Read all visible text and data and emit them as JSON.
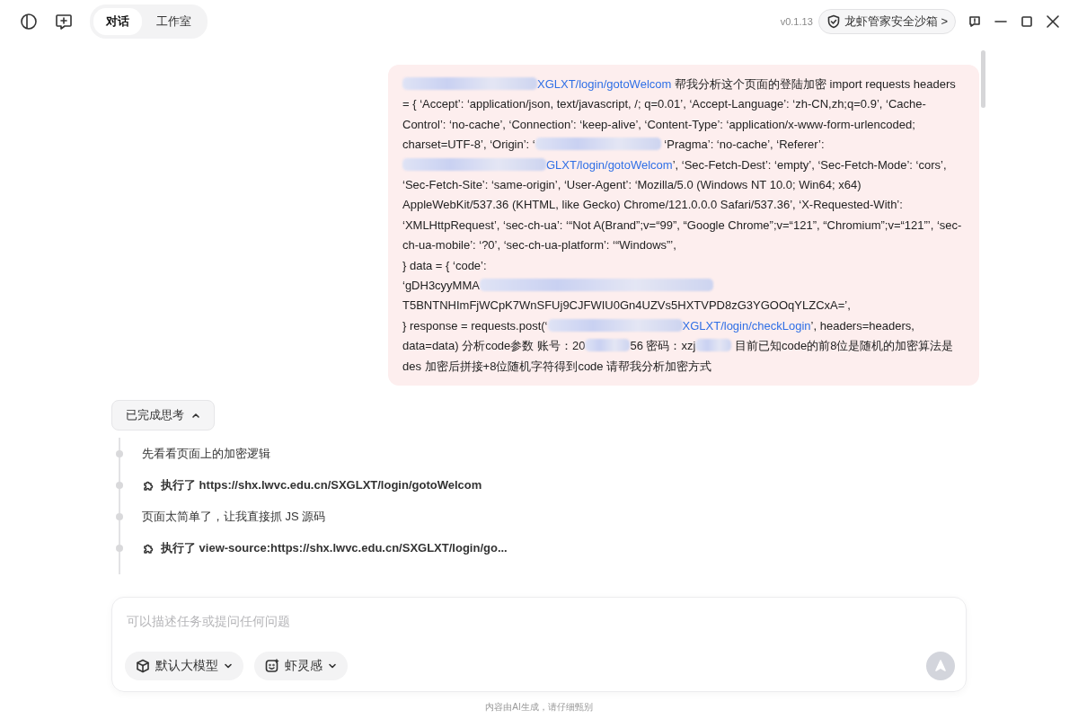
{
  "header": {
    "tabs": [
      {
        "label": "对话",
        "selected": true
      },
      {
        "label": "工作室",
        "selected": false
      }
    ],
    "version": "v0.1.13",
    "sandbox_button": "龙虾管家安全沙箱 >"
  },
  "message": {
    "segments": [
      {
        "kind": "redacted"
      },
      {
        "kind": "link",
        "text": "XGLXT/login/gotoWelcom"
      },
      {
        "kind": "text",
        "text": " 帮我分析这个页面的登陆加密 import requests headers = { ‘Accept’: ‘application/json, text/javascript, /; q=0.01’, ‘Accept-Language’: ‘zh-CN,zh;q=0.9’, ‘Cache-Control’: ‘no-cache’, ‘Connection’: ‘keep-alive’, ‘Content-Type’: ‘application/x-www-form-urlencoded; charset=UTF-8’, ‘Origin’: ‘"
      },
      {
        "kind": "redacted"
      },
      {
        "kind": "text",
        "text": " ‘Pragma’: ‘no-cache’, ‘Referer’: "
      },
      {
        "kind": "redacted"
      },
      {
        "kind": "link",
        "text": "GLXT/login/gotoWelcom"
      },
      {
        "kind": "text",
        "text": "’, ‘Sec-Fetch-Dest’: ‘empty’, ‘Sec-Fetch-Mode’: ‘cors’, ‘Sec-Fetch-Site’: ‘same-origin’, ‘User-Agent’: ‘Mozilla/5.0 (Windows NT 10.0; Win64; x64) AppleWebKit/537.36 (KHTML, like Gecko) Chrome/121.0.0.0 Safari/537.36’, ‘X-Requested-With’: ‘XMLHttpRequest’, ‘sec-ch-ua’: ‘“Not A(Brand”;v=“99”, “Google Chrome”;v=“121”, “Chromium”;v=“121”’, ‘sec-ch-ua-mobile’: ‘?0’, ‘sec-ch-ua-platform’: ‘“Windows”’,"
      },
      {
        "kind": "break"
      },
      {
        "kind": "text",
        "text": "} data = { ‘code’:"
      },
      {
        "kind": "break"
      },
      {
        "kind": "text",
        "text": "‘gDH3cyyMMA"
      },
      {
        "kind": "redacted"
      },
      {
        "kind": "text",
        "text": "T5BNTNHImFjWCpK7WnSFUj9CJFWIU0Gn4UZVs5HXTVPD8zG3YGOOqYLZCxA=’,"
      },
      {
        "kind": "break"
      },
      {
        "kind": "text",
        "text": "} response = requests.post(‘"
      },
      {
        "kind": "redacted"
      },
      {
        "kind": "link",
        "text": "XGLXT/login/checkLogin"
      },
      {
        "kind": "text",
        "text": "’, headers=headers, data=data) 分析code参数 账号：20"
      },
      {
        "kind": "redacted"
      },
      {
        "kind": "text",
        "text": "56 密码：xzj"
      },
      {
        "kind": "redacted"
      },
      {
        "kind": "text",
        "text": " 目前已知code的前8位是随机的加密算法是des 加密后拼接+8位随机字符得到code 请帮我分析加密方式"
      }
    ]
  },
  "thinking": {
    "label": "已完成思考",
    "expanded": true,
    "steps": [
      {
        "kind": "note",
        "text": "先看看页面上的加密逻辑"
      },
      {
        "kind": "action",
        "text": "执行了 https://shx.lwvc.edu.cn/SXGLXT/login/gotoWelcom"
      },
      {
        "kind": "note",
        "text": "页面太简单了，让我直接抓 JS 源码"
      },
      {
        "kind": "action",
        "text": "执行了 view-source:https://shx.lwvc.edu.cn/SXGLXT/login/go..."
      }
    ]
  },
  "composer": {
    "placeholder": "可以描述任务或提问任何问题",
    "chips": [
      {
        "kind": "model",
        "label": "默认大模型"
      },
      {
        "kind": "mood",
        "label": "虾灵感"
      }
    ]
  },
  "footer": "内容由AI生成，请仔细甄别"
}
